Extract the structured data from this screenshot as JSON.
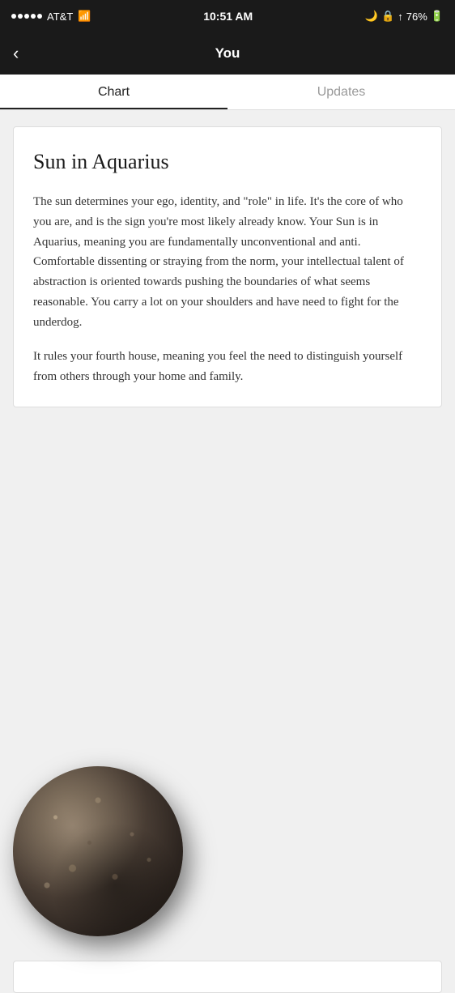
{
  "status_bar": {
    "carrier": "AT&T",
    "signal_label": "●●●●●",
    "wifi_label": "WiFi",
    "time": "10:51 AM",
    "moon_icon": "🌙",
    "location_icon": "↑",
    "battery_percent": "76%"
  },
  "nav": {
    "back_label": "‹",
    "title": "You"
  },
  "tabs": {
    "chart_label": "Chart",
    "updates_label": "Updates"
  },
  "card": {
    "title": "Sun in Aquarius",
    "paragraph1": "The sun determines your ego, identity, and \"role\" in life. It's the core of who you are, and is the sign you're most likely already know. Your Sun is in Aquarius, meaning you are fundamentally unconventional and anti. Comfortable dissenting or straying from the norm, your intellectual talent of abstraction is oriented towards pushing the boundaries of what seems reasonable. You carry a lot on your shoulders and have need to fight for the underdog.",
    "paragraph2": "It rules your fourth house, meaning you feel the need to distinguish yourself from others through your home and family."
  }
}
